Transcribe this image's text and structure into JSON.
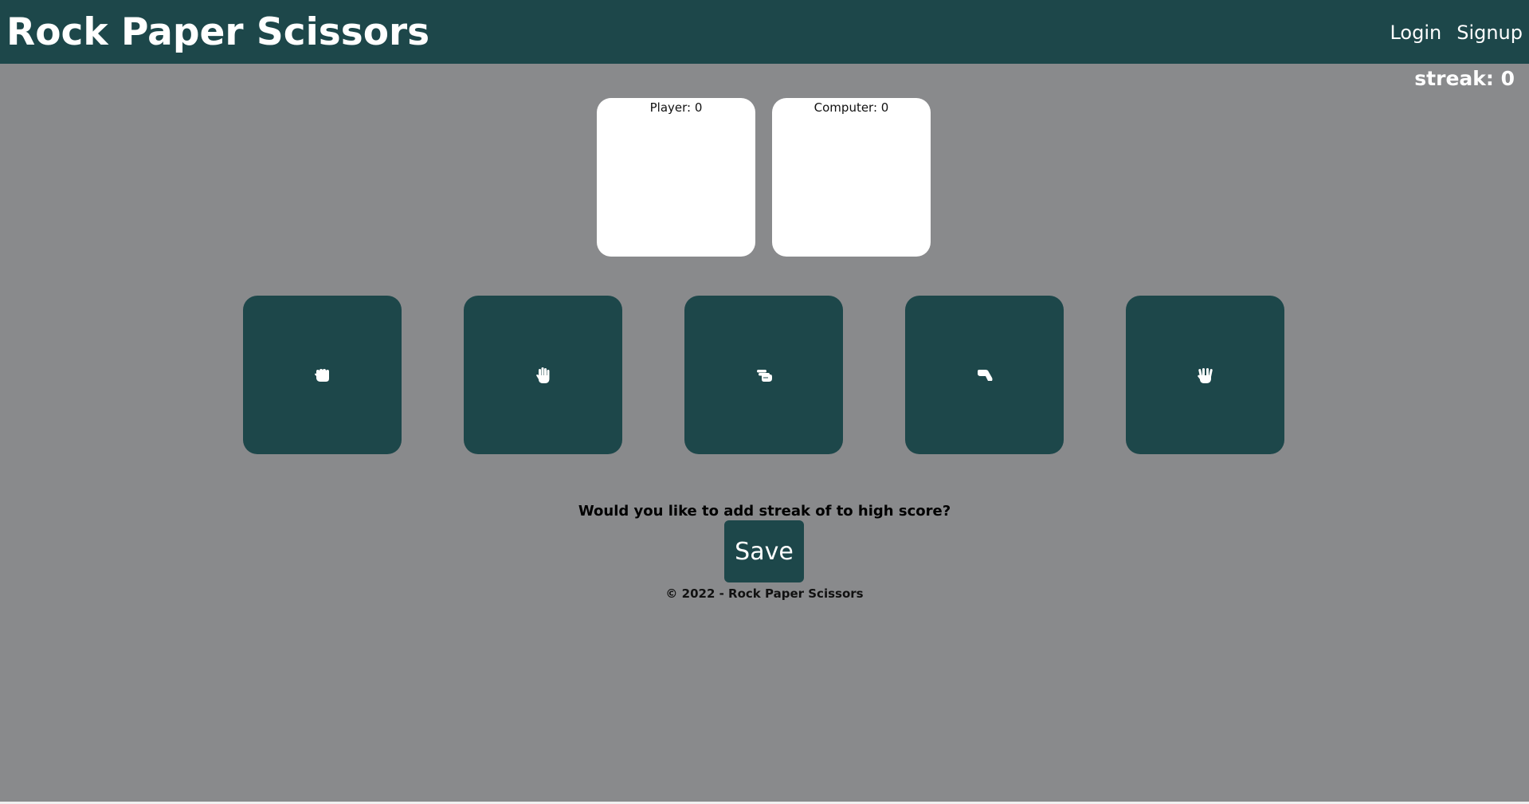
{
  "navbar": {
    "brand": "Rock Paper Scissors",
    "links": [
      "Login",
      "Signup"
    ]
  },
  "streak": "streak: 0",
  "scoreboard": {
    "player": "Player: 0",
    "computer": "Computer: 0"
  },
  "choices": [
    {
      "name": "rock",
      "icon": "hand-rock-icon"
    },
    {
      "name": "paper",
      "icon": "hand-paper-icon"
    },
    {
      "name": "scissors",
      "icon": "hand-scissors-icon"
    },
    {
      "name": "lizard",
      "icon": "hand-lizard-icon"
    },
    {
      "name": "spock",
      "icon": "hand-spock-icon"
    }
  ],
  "prompt": "Would you like to add streak of to high score?",
  "save_label": "Save",
  "footer": "© 2022 - Rock Paper Scissors",
  "colors": {
    "background": "#898a8c",
    "primary": "#1d474a",
    "card": "#ffffff"
  }
}
